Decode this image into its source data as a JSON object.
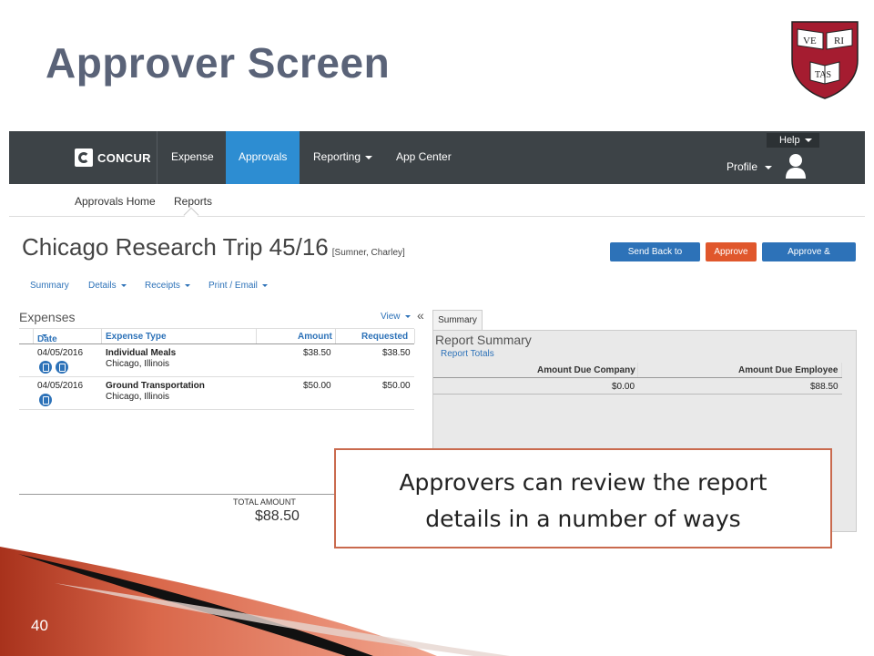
{
  "slide": {
    "title": "Approver Screen",
    "page_number": "40",
    "crest_text": {
      "top_left": "VE",
      "top_right": "RI",
      "bottom": "TAS"
    },
    "callout": {
      "line1": "Approvers can review the report",
      "line2": "details in a number of ways"
    }
  },
  "app": {
    "logo": "CONCUR",
    "nav": {
      "expense": "Expense",
      "approvals": "Approvals",
      "reporting": "Reporting",
      "app_center": "App Center"
    },
    "help": "Help",
    "profile": "Profile",
    "subnav": {
      "home": "Approvals Home",
      "reports": "Reports"
    },
    "report": {
      "title": "Chicago Research Trip 45/16",
      "user": "[Sumner, Charley]"
    },
    "buttons": {
      "send_back": "Send Back to User",
      "approve": "Approve",
      "approve_forward": "Approve & Forward"
    },
    "tabs": {
      "summary": "Summary",
      "details": "Details",
      "receipts": "Receipts",
      "print": "Print / Email"
    },
    "expenses": {
      "title": "Expenses",
      "view": "View",
      "collapse": "«",
      "columns": {
        "date": "Date",
        "type": "Expense Type",
        "amount": "Amount",
        "requested": "Requested"
      },
      "rows": [
        {
          "date": "04/05/2016",
          "type": "Individual Meals",
          "location": "Chicago, Illinois",
          "amount": "$38.50",
          "requested": "$38.50"
        },
        {
          "date": "04/05/2016",
          "type": "Ground Transportation",
          "location": "Chicago, Illinois",
          "amount": "$50.00",
          "requested": "$50.00"
        }
      ],
      "total_label": "TOTAL AMOUNT",
      "total_value": "$88.50"
    },
    "summary_panel": {
      "tab": "Summary",
      "title": "Report Summary",
      "totals_link": "Report Totals",
      "columns": {
        "company": "Amount Due Company",
        "employee": "Amount Due Employee"
      },
      "row": {
        "company": "$0.00",
        "employee": "$88.50"
      }
    }
  },
  "colors": {
    "title": "#5a6378",
    "topbar": "#3d4347",
    "active_nav": "#2d8dd2",
    "link_blue": "#2d72b8",
    "approve_orange": "#e0572c",
    "callout_border": "#c96a4e",
    "crest_red": "#a51c30"
  }
}
